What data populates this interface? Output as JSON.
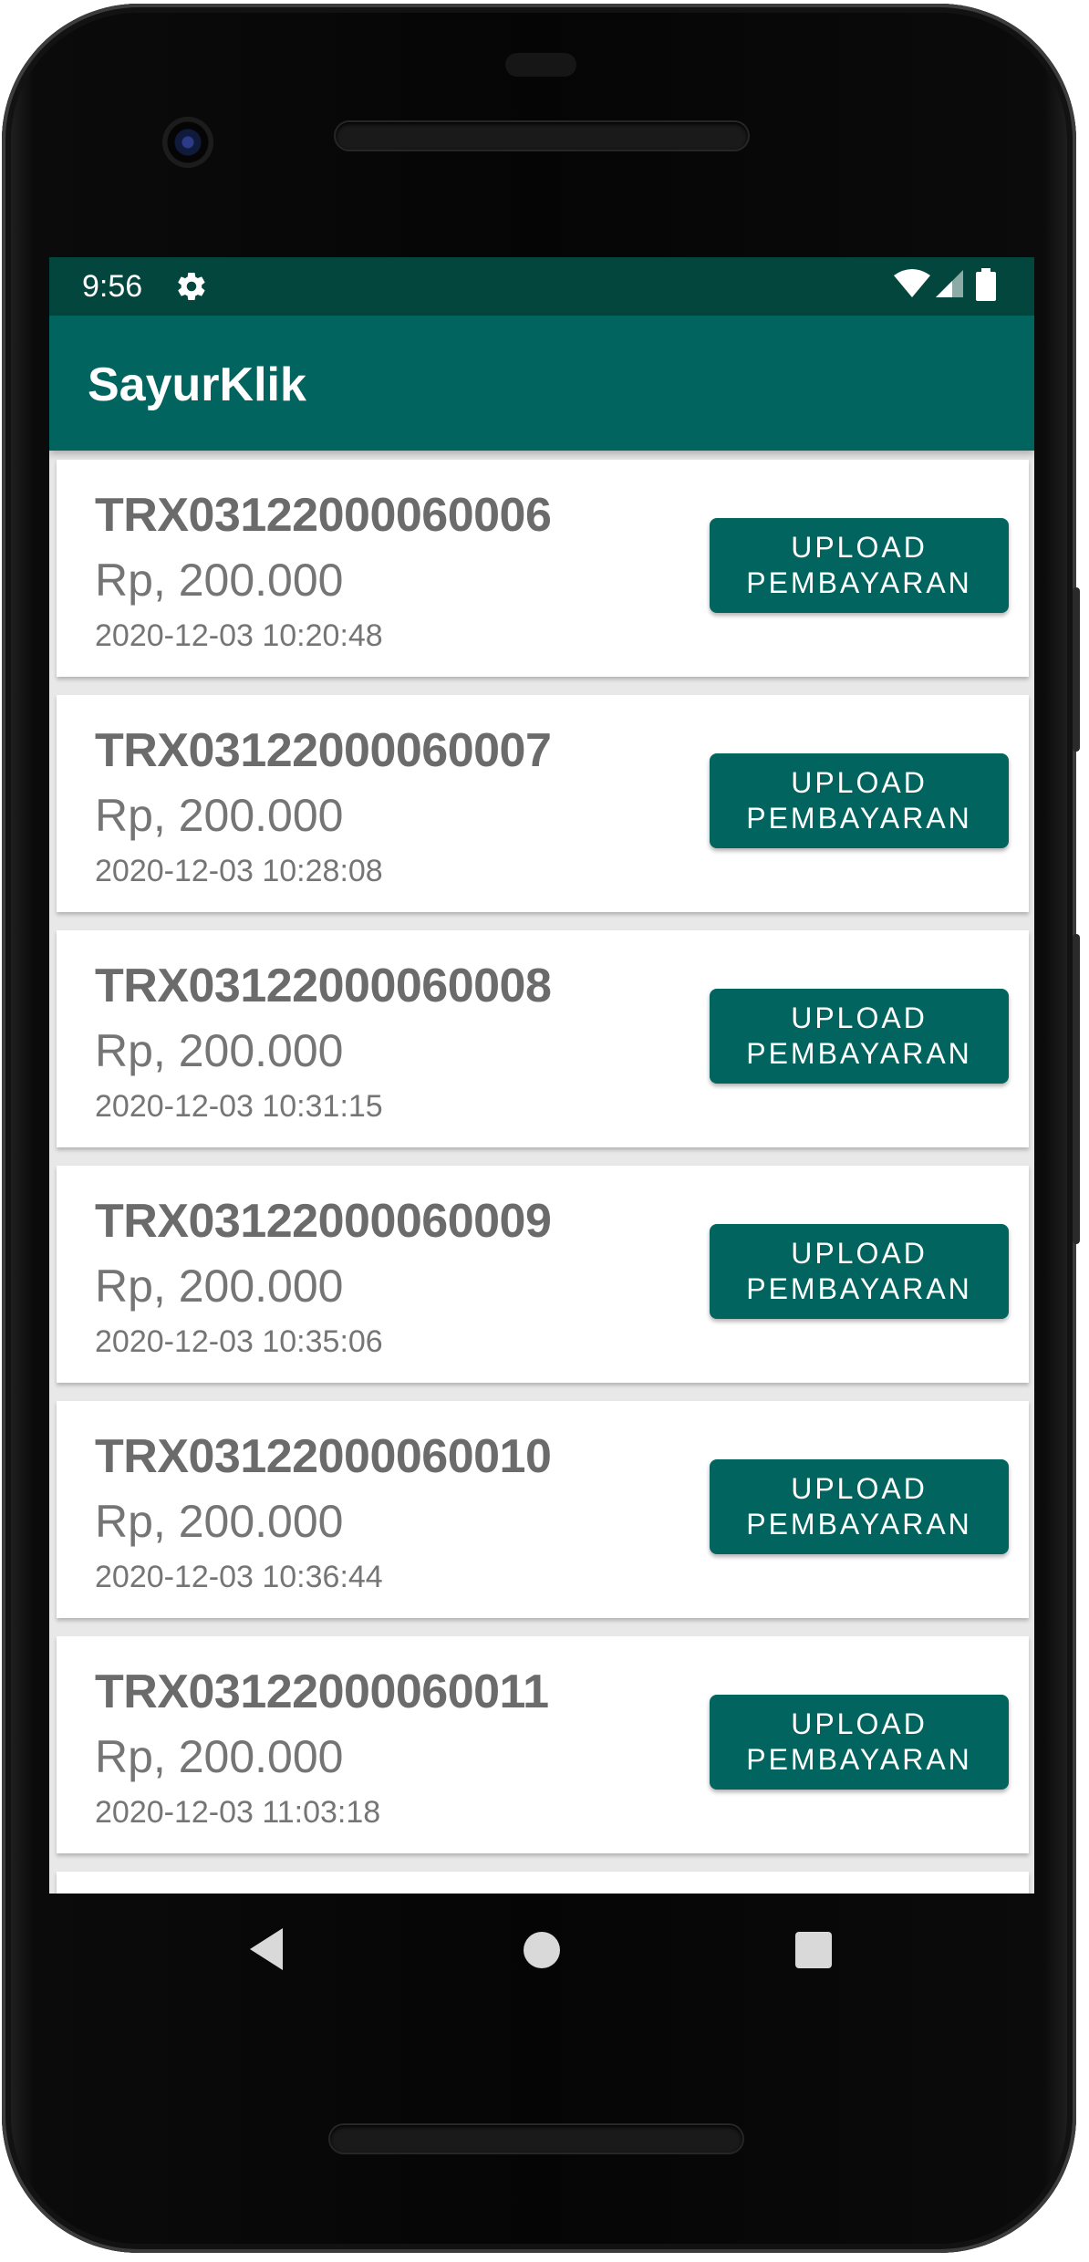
{
  "status_bar": {
    "time": "9:56",
    "icons": [
      "gear-icon",
      "wifi-icon",
      "signal-icon",
      "battery-icon"
    ],
    "background": "#02463d"
  },
  "app_bar": {
    "title": "SayurKlik",
    "background": "#02645f"
  },
  "transactions": [
    {
      "id": "TRX03122000060006",
      "amount": "Rp, 200.000",
      "date": "2020-12-03 10:20:48",
      "button_line1": "UPLOAD",
      "button_line2": "PEMBAYARAN"
    },
    {
      "id": "TRX03122000060007",
      "amount": "Rp, 200.000",
      "date": "2020-12-03 10:28:08",
      "button_line1": "UPLOAD",
      "button_line2": "PEMBAYARAN"
    },
    {
      "id": "TRX03122000060008",
      "amount": "Rp, 200.000",
      "date": "2020-12-03 10:31:15",
      "button_line1": "UPLOAD",
      "button_line2": "PEMBAYARAN"
    },
    {
      "id": "TRX03122000060009",
      "amount": "Rp, 200.000",
      "date": "2020-12-03 10:35:06",
      "button_line1": "UPLOAD",
      "button_line2": "PEMBAYARAN"
    },
    {
      "id": "TRX03122000060010",
      "amount": "Rp, 200.000",
      "date": "2020-12-03 10:36:44",
      "button_line1": "UPLOAD",
      "button_line2": "PEMBAYARAN"
    },
    {
      "id": "TRX03122000060011",
      "amount": "Rp, 200.000",
      "date": "2020-12-03 11:03:18",
      "button_line1": "UPLOAD",
      "button_line2": "PEMBAYARAN"
    }
  ],
  "nav_bar": {
    "icons": [
      "back-icon",
      "home-icon",
      "recents-icon"
    ]
  },
  "colors": {
    "accent": "#02645f",
    "card_text": "#6b6b6b",
    "list_background": "#e8e8e8"
  }
}
